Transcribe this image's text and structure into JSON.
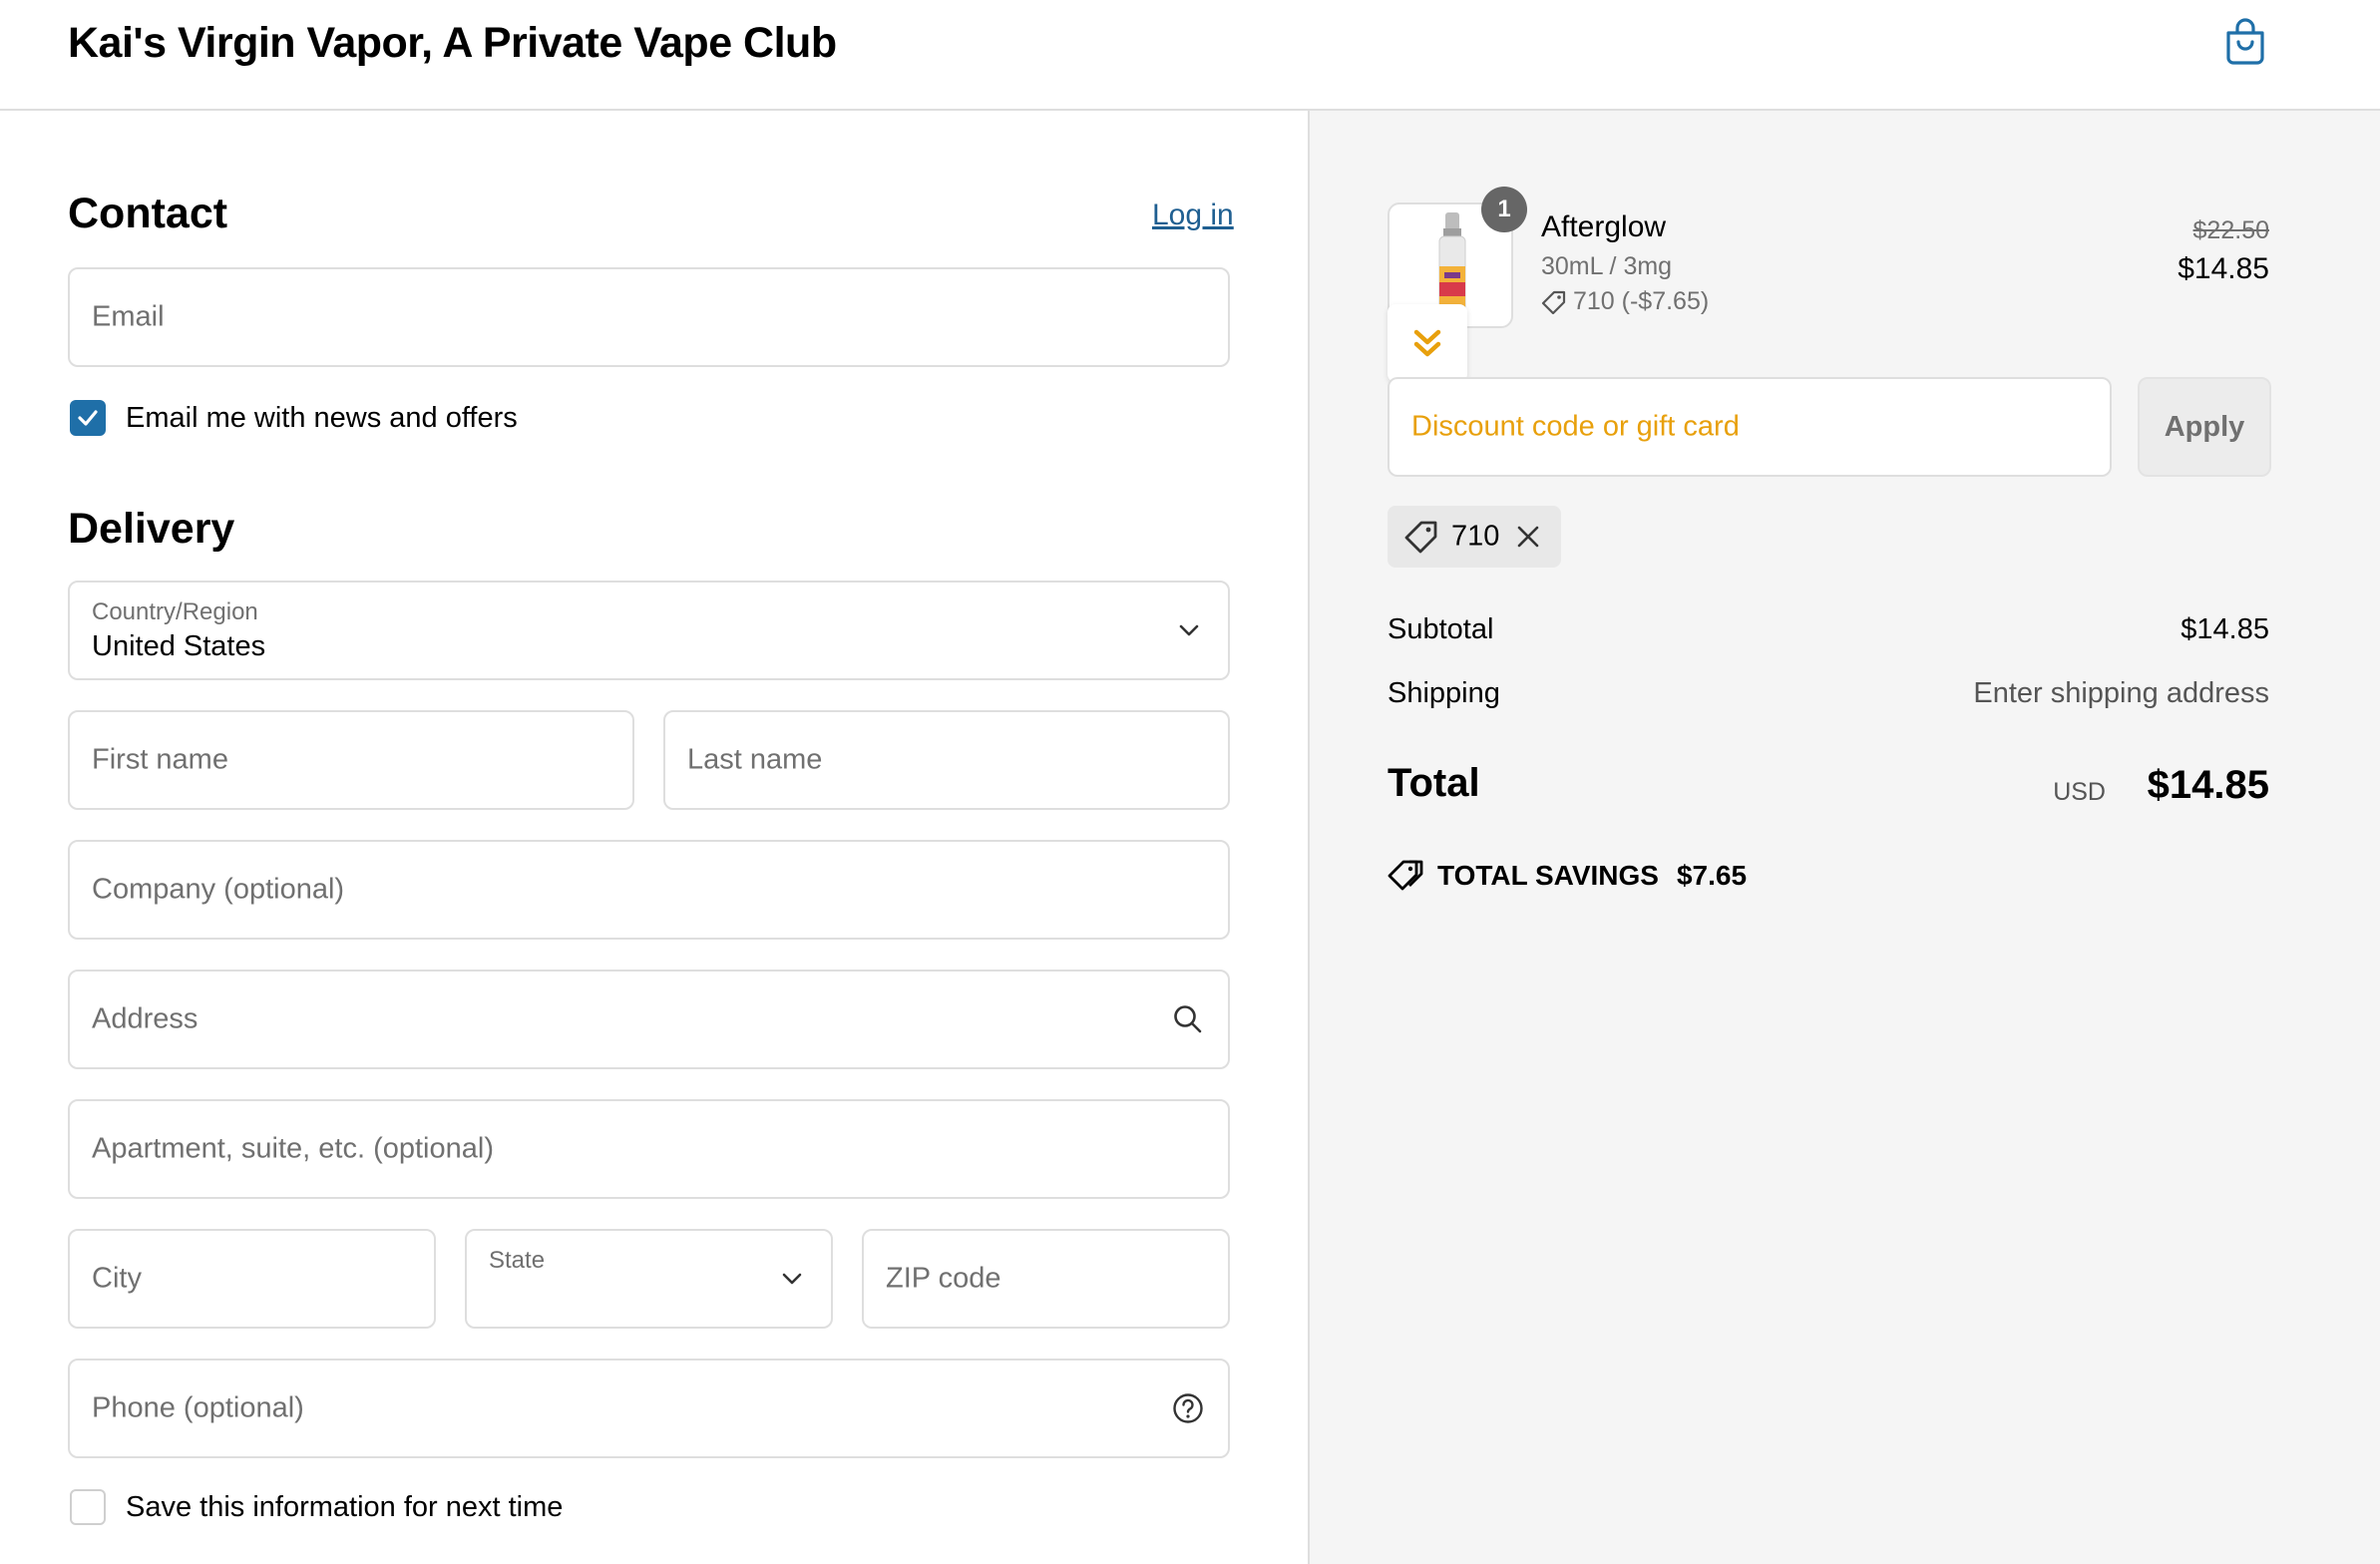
{
  "header": {
    "store_title": "Kai's Virgin Vapor, A Private Vape Club",
    "cart_icon": "shopping-bag-icon"
  },
  "contact": {
    "title": "Contact",
    "login_link": "Log in",
    "email_placeholder": "Email",
    "newsletter_label": "Email me with news and offers",
    "newsletter_checked": true
  },
  "delivery": {
    "title": "Delivery",
    "country_label": "Country/Region",
    "country_value": "United States",
    "first_name_placeholder": "First name",
    "last_name_placeholder": "Last name",
    "company_placeholder": "Company (optional)",
    "address_placeholder": "Address",
    "apartment_placeholder": "Apartment, suite, etc. (optional)",
    "city_placeholder": "City",
    "state_label": "State",
    "zip_placeholder": "ZIP code",
    "phone_placeholder": "Phone (optional)",
    "save_info_label": "Save this information for next time",
    "save_info_checked": false
  },
  "summary": {
    "product": {
      "quantity": "1",
      "name": "Afterglow",
      "variant": "30mL / 3mg",
      "discount": "710 (-$7.65)",
      "original_price": "$22.50",
      "price": "$14.85"
    },
    "discount_placeholder": "Discount code or gift card",
    "apply_label": "Apply",
    "applied_code": "710",
    "subtotal_label": "Subtotal",
    "subtotal_value": "$14.85",
    "shipping_label": "Shipping",
    "shipping_value": "Enter shipping address",
    "total_label": "Total",
    "total_currency": "USD",
    "total_value": "$14.85",
    "savings_label": "TOTAL SAVINGS",
    "savings_value": "$7.65"
  },
  "colors": {
    "accent": "#1f6fa8",
    "link": "#1f5f91",
    "discount_placeholder": "#e8a00c",
    "summary_bg": "#f5f5f5"
  }
}
